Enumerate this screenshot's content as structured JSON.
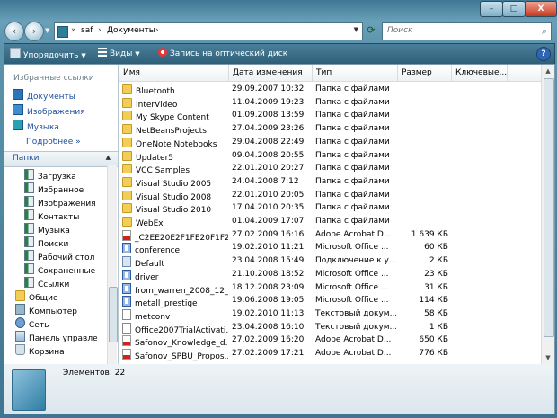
{
  "window": {
    "min_label": "–",
    "max_label": "□",
    "close_label": "X"
  },
  "nav": {
    "back_icon": "‹",
    "fwd_icon": "›"
  },
  "address": {
    "sep1": "»",
    "seg1": "saf",
    "sep2": "›",
    "seg2": "Документы",
    "sep3": "›"
  },
  "search": {
    "placeholder": "Поиск",
    "icon": "⌕"
  },
  "toolbar": {
    "organize_label": "Упорядочить",
    "views_label": "Виды",
    "burn_label": "Запись на оптический диск",
    "help_label": "?"
  },
  "sidebar": {
    "favorites_title": "Избранные ссылки",
    "favorites": [
      {
        "label": "Документы"
      },
      {
        "label": "Изображения"
      },
      {
        "label": "Музыка"
      }
    ],
    "more_label": "Подробнее  »",
    "folders_label": "Папки",
    "tree": [
      {
        "label": "Загрузка",
        "icon": "library"
      },
      {
        "label": "Избранное",
        "icon": "library"
      },
      {
        "label": "Изображения",
        "icon": "library"
      },
      {
        "label": "Контакты",
        "icon": "library"
      },
      {
        "label": "Музыка",
        "icon": "library"
      },
      {
        "label": "Поиски",
        "icon": "library"
      },
      {
        "label": "Рабочий стол",
        "icon": "library"
      },
      {
        "label": "Сохраненные",
        "icon": "library"
      },
      {
        "label": "Ссылки",
        "icon": "library"
      },
      {
        "label": "Общие",
        "icon": "folder"
      },
      {
        "label": "Компьютер",
        "icon": "computer"
      },
      {
        "label": "Сеть",
        "icon": "network"
      },
      {
        "label": "Панель управле",
        "icon": "control-panel"
      },
      {
        "label": "Корзина",
        "icon": "recycle-bin"
      }
    ]
  },
  "columns": {
    "name": "Имя",
    "date": "Дата изменения",
    "type": "Тип",
    "size": "Размер",
    "tags": "Ключевые..."
  },
  "files": [
    {
      "name": "Bluetooth",
      "date": "29.09.2007 10:32",
      "type": "Папка с файлами",
      "size": "",
      "icon": "folder"
    },
    {
      "name": "InterVideo",
      "date": "11.04.2009 19:23",
      "type": "Папка с файлами",
      "size": "",
      "icon": "folder"
    },
    {
      "name": "My Skype Content",
      "date": "01.09.2008 13:59",
      "type": "Папка с файлами",
      "size": "",
      "icon": "folder"
    },
    {
      "name": "NetBeansProjects",
      "date": "27.04.2009 23:26",
      "type": "Папка с файлами",
      "size": "",
      "icon": "folder"
    },
    {
      "name": "OneNote Notebooks",
      "date": "29.04.2008 22:49",
      "type": "Папка с файлами",
      "size": "",
      "icon": "folder"
    },
    {
      "name": "Updater5",
      "date": "09.04.2008 20:55",
      "type": "Папка с файлами",
      "size": "",
      "icon": "folder"
    },
    {
      "name": "VCC Samples",
      "date": "22.01.2010 20:27",
      "type": "Папка с файлами",
      "size": "",
      "icon": "folder"
    },
    {
      "name": "Visual Studio 2005",
      "date": "24.04.2008 7:12",
      "type": "Папка с файлами",
      "size": "",
      "icon": "folder"
    },
    {
      "name": "Visual Studio 2008",
      "date": "22.01.2010 20:05",
      "type": "Папка с файлами",
      "size": "",
      "icon": "folder"
    },
    {
      "name": "Visual Studio 2010",
      "date": "17.04.2010 20:35",
      "type": "Папка с файлами",
      "size": "",
      "icon": "folder"
    },
    {
      "name": "WebEx",
      "date": "01.04.2009 17:07",
      "type": "Папка с файлами",
      "size": "",
      "icon": "folder"
    },
    {
      "name": "_C2EE20E2F1FE20F1F2F...",
      "date": "27.02.2009 16:16",
      "type": "Adobe Acrobat D...",
      "size": "1 639 КБ",
      "icon": "pdf"
    },
    {
      "name": "conference",
      "date": "19.02.2010 11:21",
      "type": "Microsoft Office ...",
      "size": "60 КБ",
      "icon": "doc"
    },
    {
      "name": "Default",
      "date": "23.04.2008 15:49",
      "type": "Подключение к у...",
      "size": "2 КБ",
      "icon": "link"
    },
    {
      "name": "driver",
      "date": "21.10.2008 18:52",
      "type": "Microsoft Office ...",
      "size": "23 КБ",
      "icon": "doc"
    },
    {
      "name": "from_warren_2008_12_18",
      "date": "18.12.2008 23:09",
      "type": "Microsoft Office ...",
      "size": "31 КБ",
      "icon": "doc"
    },
    {
      "name": "metall_prestige",
      "date": "19.06.2008 19:05",
      "type": "Microsoft Office ...",
      "size": "114 КБ",
      "icon": "doc"
    },
    {
      "name": "metconv",
      "date": "19.02.2010 11:13",
      "type": "Текстовый докум...",
      "size": "58 КБ",
      "icon": "txt"
    },
    {
      "name": "Office2007TrialActivati...",
      "date": "23.04.2008 16:10",
      "type": "Текстовый докум...",
      "size": "1 КБ",
      "icon": "txt"
    },
    {
      "name": "Safonov_Knowledge_d...",
      "date": "27.02.2009 16:20",
      "type": "Adobe Acrobat D...",
      "size": "650 КБ",
      "icon": "pdf"
    },
    {
      "name": "Safonov_SPBU_Propos...",
      "date": "27.02.2009 17:21",
      "type": "Adobe Acrobat D...",
      "size": "776 КБ",
      "icon": "pdf"
    }
  ],
  "details": {
    "count_label": "Элементов: 22"
  }
}
